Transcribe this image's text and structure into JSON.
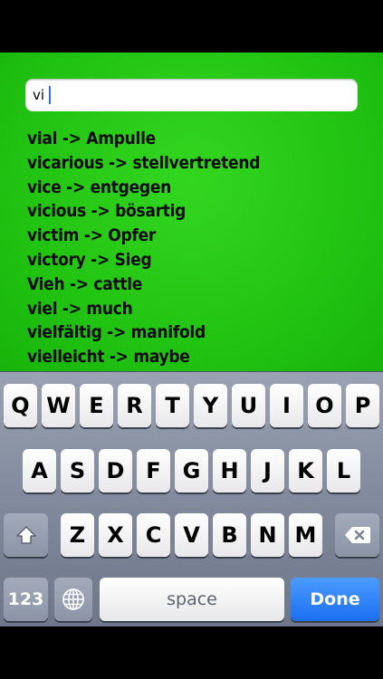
{
  "search": {
    "value": "vi"
  },
  "results": [
    "vial -> Ampulle",
    "vicarious -> stellvertretend",
    "vice -> entgegen",
    "vicious -> bösartig",
    "victim -> Opfer",
    "victory -> Sieg",
    "Vieh -> cattle",
    "viel -> much",
    "vielfältig -> manifold",
    "vielleicht -> maybe"
  ],
  "keyboard": {
    "row1": [
      "Q",
      "W",
      "E",
      "R",
      "T",
      "Y",
      "U",
      "I",
      "O",
      "P"
    ],
    "row2": [
      "A",
      "S",
      "D",
      "F",
      "G",
      "H",
      "J",
      "K",
      "L"
    ],
    "row3": [
      "Z",
      "X",
      "C",
      "V",
      "B",
      "N",
      "M"
    ],
    "numbers_label": "123",
    "space_label": "space",
    "done_label": "Done",
    "shift_icon": "shift-arrow-icon",
    "delete_icon": "backspace-icon",
    "globe_icon": "globe-icon"
  },
  "colors": {
    "background_green": "#22c412",
    "done_blue": "#1c6ff0"
  }
}
